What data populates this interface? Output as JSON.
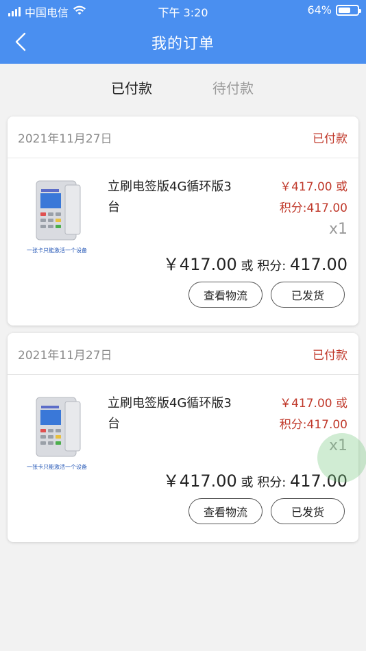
{
  "status_bar": {
    "carrier": "中国电信",
    "time": "下午 3:20",
    "battery": "64%",
    "battery_level": 0.64
  },
  "nav": {
    "title": "我的订单"
  },
  "tabs": [
    {
      "label": "已付款",
      "active": true
    },
    {
      "label": "待付款",
      "active": false
    }
  ],
  "orders": [
    {
      "date": "2021年11月27日",
      "status": "已付款",
      "product_name": "立刷电签版4G循环版3台",
      "unit_price_line1": "￥417.00 或",
      "unit_price_line2": "积分:417.00",
      "qty": "x1",
      "total_price": "￥417.00",
      "total_mid": " 或 积分: ",
      "total_points": "417.00",
      "thumb_caption": "一张卡只能激活一个设备",
      "buttons": {
        "logistics": "查看物流",
        "shipped": "已发货"
      }
    },
    {
      "date": "2021年11月27日",
      "status": "已付款",
      "product_name": "立刷电签版4G循环版3台",
      "unit_price_line1": "￥417.00 或",
      "unit_price_line2": "积分:417.00",
      "qty": "x1",
      "total_price": "￥417.00",
      "total_mid": " 或 积分: ",
      "total_points": "417.00",
      "thumb_caption": "一张卡只能激活一个设备",
      "buttons": {
        "logistics": "查看物流",
        "shipped": "已发货"
      }
    }
  ],
  "colors": {
    "header_blue": "#4a8ff0",
    "price_red": "#c0392b",
    "background": "#f2f2f2"
  }
}
